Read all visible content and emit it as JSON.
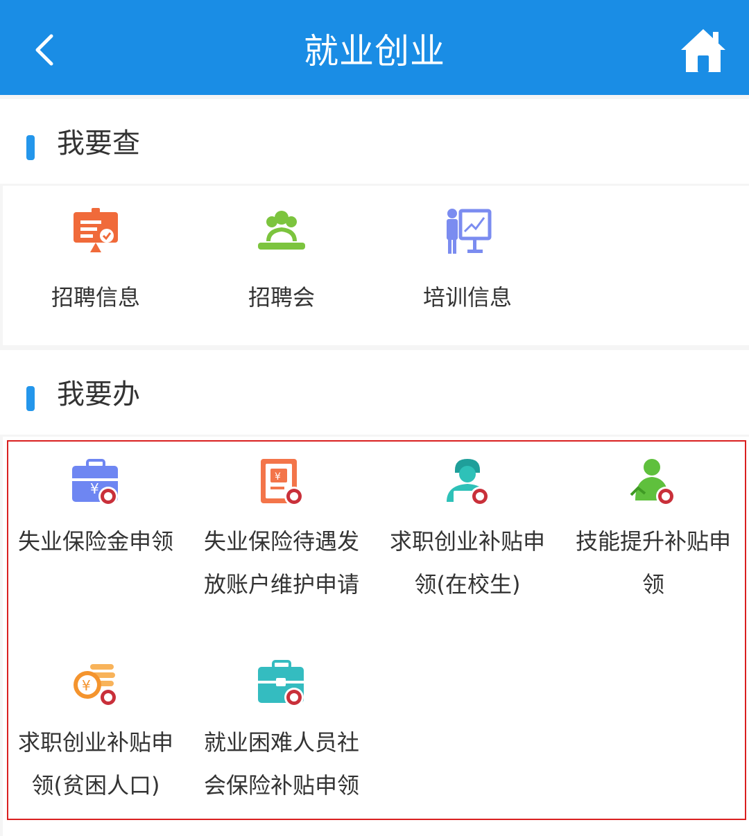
{
  "header": {
    "title": "就业创业",
    "back_icon": "chevron-left-icon",
    "home_icon": "home-icon",
    "background": "#1a8de5"
  },
  "query_section": {
    "title": "我要查",
    "items": [
      {
        "label": "招聘信息",
        "icon": "presentation-board-icon",
        "color": "#f06a3a"
      },
      {
        "label": "招聘会",
        "icon": "meeting-people-icon",
        "color": "#7cc43e"
      },
      {
        "label": "培训信息",
        "icon": "trainer-chart-icon",
        "color": "#7b8cf0"
      }
    ]
  },
  "handle_section": {
    "title": "我要办",
    "items": [
      {
        "label_line1": "失业保险金申领",
        "label_line2": "",
        "icon": "wallet-yuan-icon",
        "color": "#6e86f2"
      },
      {
        "label_line1": "失业保险待遇发",
        "label_line2": "放账户维护申请",
        "icon": "document-yuan-icon",
        "color": "#f3754a"
      },
      {
        "label_line1": "求职创业补贴申",
        "label_line2": "领(在校生)",
        "icon": "student-laptop-icon",
        "color": "#2ec1b8"
      },
      {
        "label_line1": "技能提升补贴申",
        "label_line2": "领",
        "icon": "person-upgrade-icon",
        "color": "#5fc03d"
      },
      {
        "label_line1": "求职创业补贴申",
        "label_line2": "领(贫困人口)",
        "icon": "coin-yuan-icon",
        "color": "#f4942e"
      },
      {
        "label_line1": "就业困难人员社",
        "label_line2": "会保险补贴申领",
        "icon": "briefcase-icon",
        "color": "#34bcc0"
      }
    ]
  }
}
